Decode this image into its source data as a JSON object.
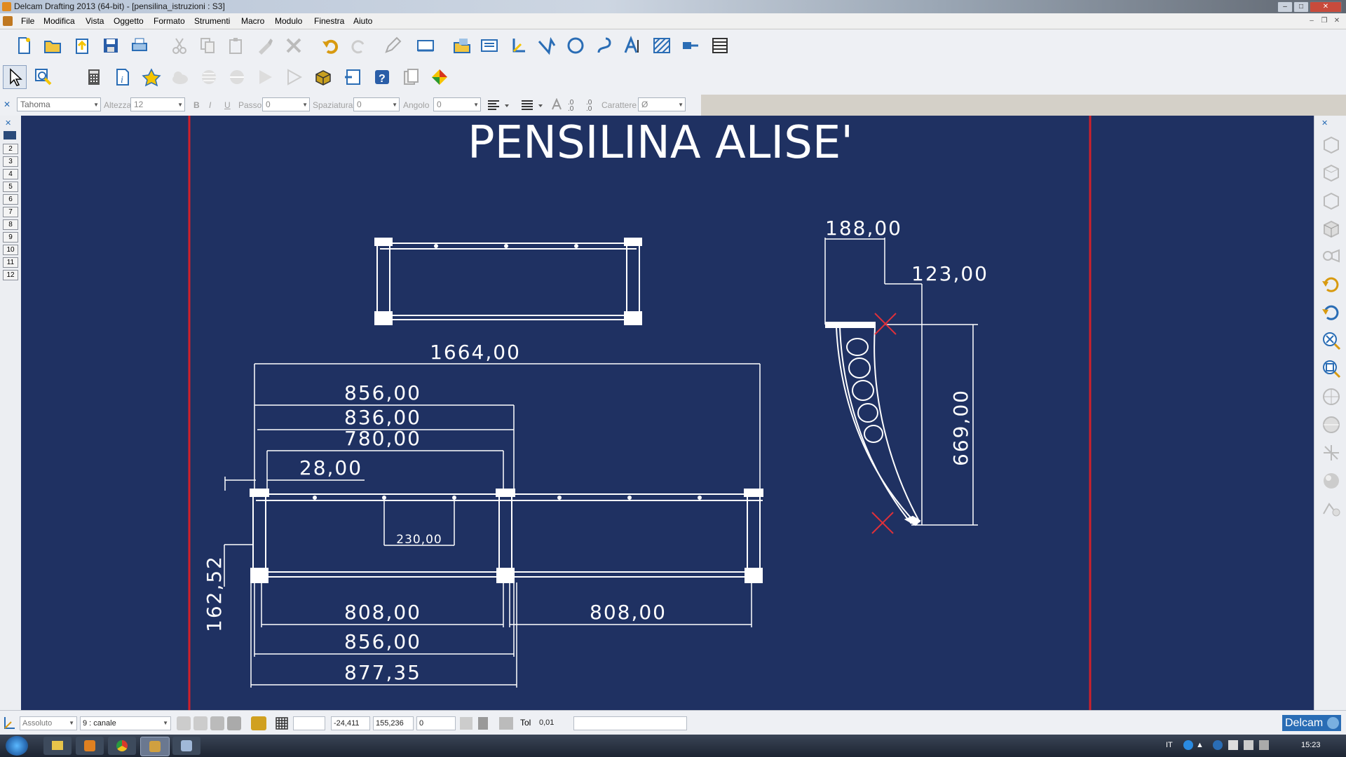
{
  "window": {
    "title": "Delcam Drafting 2013 (64-bit) - [pensilina_istruzioni : S3]"
  },
  "menu": [
    "File",
    "Modifica",
    "Vista",
    "Oggetto",
    "Formato",
    "Strumenti",
    "Macro",
    "Modulo",
    "Finestra",
    "Aiuto"
  ],
  "text_toolbar": {
    "font": "Tahoma",
    "height_label": "Altezza",
    "height_value": "12",
    "pitch_label": "Passo",
    "pitch_value": "0",
    "spacing_label": "Spaziatura",
    "spacing_value": "0",
    "angle_label": "Angolo",
    "angle_value": "0",
    "char_label": "Carattere",
    "char_value": "Ø",
    "bold_label": "B",
    "italic_label": "I",
    "underline_label": "U",
    "zero_a": ".0",
    "zero_b": ".0",
    "zero_c": ".0",
    "zero_d": ".0"
  },
  "pages": [
    "2",
    "3",
    "4",
    "5",
    "6",
    "7",
    "8",
    "9",
    "10",
    "11",
    "12"
  ],
  "drawing": {
    "title": "PENSILINA ALISE'",
    "dims": {
      "overall": "1664,00",
      "d856a": "856,00",
      "d836": "836,00",
      "d780": "780,00",
      "d28": "28,00",
      "d230": "230,00",
      "d162": "162,52",
      "d808a": "808,00",
      "d808b": "808,00",
      "d856b": "856,00",
      "d877": "877,35",
      "d188": "188,00",
      "d123": "123,00",
      "d669": "669,00"
    },
    "colors": {
      "background": "#1f3162",
      "lines": "#ffffff",
      "frame": "#d0202a",
      "marker": "#e0303a"
    }
  },
  "status": {
    "mode": "Assoluto",
    "layer": "9   : canale",
    "x": "-24,411",
    "y": "155,236",
    "z": "0",
    "tol_label": "Tol",
    "tol_value": "0,01",
    "brand": "Delcam"
  },
  "taskbar": {
    "lang": "IT",
    "time": "15:23"
  }
}
